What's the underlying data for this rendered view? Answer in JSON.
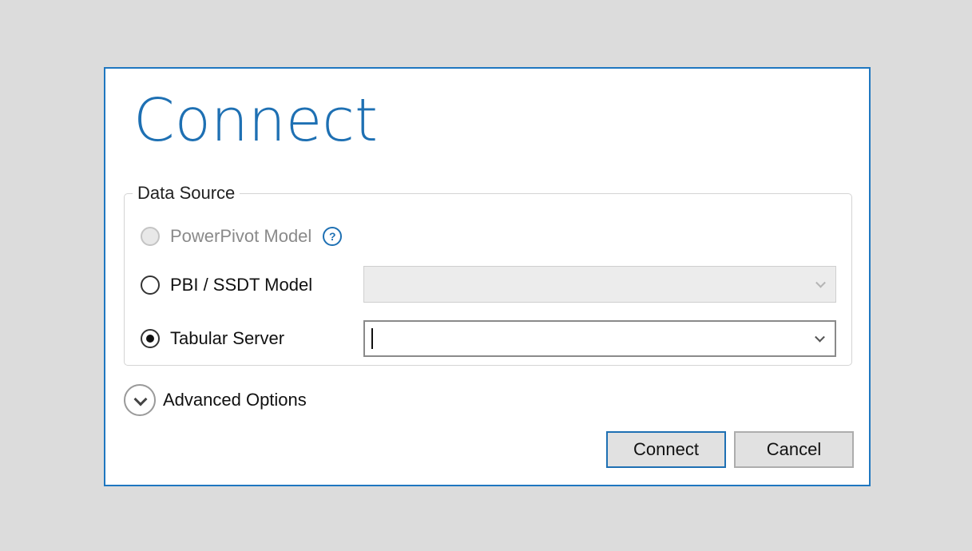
{
  "dialog": {
    "title": "Connect",
    "data_source": {
      "legend": "Data Source",
      "options": [
        {
          "label": "PowerPivot Model",
          "state": "disabled",
          "help_icon": "question-mark-icon"
        },
        {
          "label": "PBI / SSDT Model",
          "state": "unselected",
          "combo_value": ""
        },
        {
          "label": "Tabular Server",
          "state": "selected",
          "combo_value": ""
        }
      ]
    },
    "advanced": {
      "label": "Advanced Options",
      "icon": "chevron-down-circle-icon"
    },
    "buttons": {
      "connect_label": "Connect",
      "cancel_label": "Cancel"
    },
    "colors": {
      "accent": "#1e70b3",
      "background": "#dcdcdc",
      "button_face": "#e1e1e1"
    }
  }
}
